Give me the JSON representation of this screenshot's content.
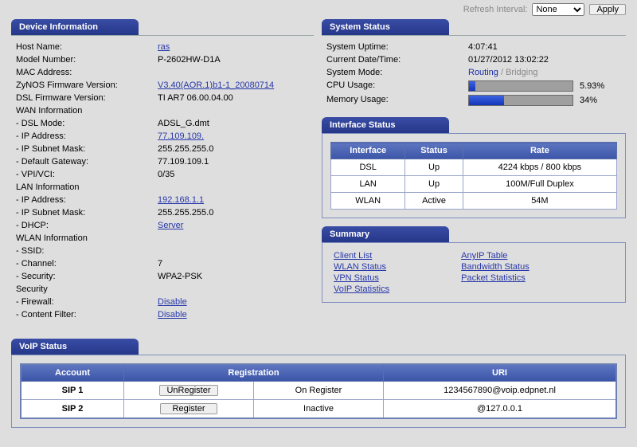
{
  "top": {
    "refresh_label": "Refresh Interval:",
    "refresh_value": "None",
    "apply": "Apply"
  },
  "device": {
    "heading": "Device Information",
    "hostname_k": "Host Name:",
    "hostname_v": "ras",
    "model_k": "Model Number:",
    "model_v": "P-2602HW-D1A",
    "mac_k": "MAC Address:",
    "mac_v": "",
    "zynos_k": "ZyNOS Firmware Version:",
    "zynos_v": "V3.40(AOR.1)b1-1_20080714",
    "dslfw_k": "DSL Firmware Version:",
    "dslfw_v": "TI AR7 06.00.04.00",
    "wan_h": "WAN Information",
    "dslmode_k": "- DSL Mode:",
    "dslmode_v": "ADSL_G.dmt",
    "ip_k": "- IP Address:",
    "ip_v": "77.109.109.",
    "mask_k": "- IP Subnet Mask:",
    "mask_v": "255.255.255.0",
    "gw_k": "- Default Gateway:",
    "gw_v": "77.109.109.1",
    "vpi_k": "- VPI/VCI:",
    "vpi_v": "0/35",
    "lan_h": "LAN Information",
    "lanip_k": "- IP Address:",
    "lanip_v": "192.168.1.1",
    "lanmask_k": "- IP Subnet Mask:",
    "lanmask_v": "255.255.255.0",
    "dhcp_k": "- DHCP:",
    "dhcp_v": "Server",
    "wlan_h": "WLAN Information",
    "ssid_k": "- SSID:",
    "ssid_v": "",
    "chan_k": "- Channel:",
    "chan_v": "7",
    "sec_k": "- Security:",
    "sec_v": "WPA2-PSK",
    "secu_h": "Security",
    "fw_k": "- Firewall:",
    "fw_v": "Disable",
    "cf_k": "- Content Filter:",
    "cf_v": "Disable"
  },
  "status": {
    "heading": "System Status",
    "uptime_k": "System Uptime:",
    "uptime_v": "4:07:41",
    "dt_k": "Current Date/Time:",
    "dt_v": "01/27/2012   13:02:22",
    "mode_k": "System Mode:",
    "mode_a": "Routing",
    "mode_sep": " / ",
    "mode_b": "Bridging",
    "cpu_k": "CPU Usage:",
    "cpu_pct": "5.93%",
    "cpu_w": "5.93%",
    "mem_k": "Memory Usage:",
    "mem_pct": "34%",
    "mem_w": "34%"
  },
  "ifc": {
    "heading": "Interface Status",
    "cols": {
      "c1": "Interface",
      "c2": "Status",
      "c3": "Rate"
    },
    "rows": [
      {
        "n": "DSL",
        "s": "Up",
        "r": "4224 kbps / 800 kbps"
      },
      {
        "n": "LAN",
        "s": "Up",
        "r": "100M/Full Duplex"
      },
      {
        "n": "WLAN",
        "s": "Active",
        "r": "54M"
      }
    ]
  },
  "summary": {
    "heading": "Summary",
    "links1": [
      "Client List",
      "WLAN Status",
      "VPN Status",
      "VoIP Statistics"
    ],
    "links2": [
      "AnyIP Table",
      "Bandwidth Status",
      "Packet Statistics"
    ]
  },
  "voip": {
    "heading": "VoIP Status",
    "cols": {
      "c1": "Account",
      "c2": "Registration",
      "c3": "",
      "c4": "URI"
    },
    "rows": [
      {
        "acc": "SIP 1",
        "btn": "UnRegister",
        "st": "On Register",
        "uri": "1234567890@voip.edpnet.nl"
      },
      {
        "acc": "SIP 2",
        "btn": "Register",
        "st": "Inactive",
        "uri": "@127.0.0.1"
      }
    ]
  }
}
